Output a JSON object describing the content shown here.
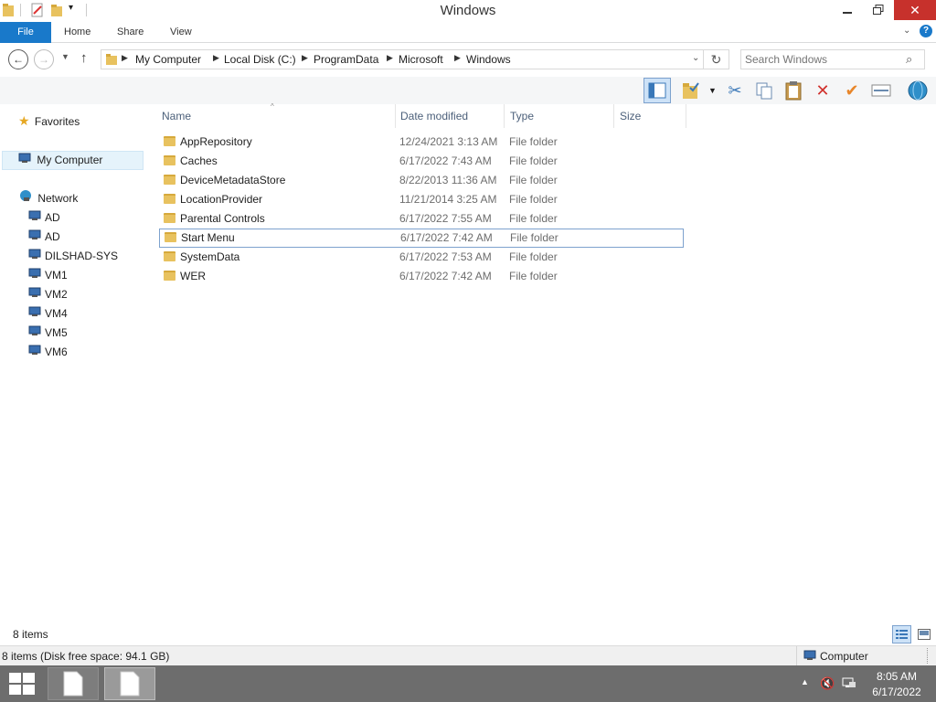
{
  "window": {
    "title": "Windows"
  },
  "ribbon": {
    "tabs": [
      "File",
      "Home",
      "Share",
      "View"
    ]
  },
  "address": {
    "crumbs": [
      "My Computer",
      "Local Disk (C:)",
      "ProgramData",
      "Microsoft",
      "Windows"
    ],
    "search_placeholder": "Search Windows"
  },
  "navpane": {
    "favorites": "Favorites",
    "my_computer": "My Computer",
    "network": "Network",
    "hosts": [
      "AD",
      "AD",
      "DILSHAD-SYS",
      "VM1",
      "VM2",
      "VM4",
      "VM5",
      "VM6"
    ]
  },
  "columns": {
    "name": "Name",
    "date": "Date modified",
    "type": "Type",
    "size": "Size"
  },
  "files": [
    {
      "name": "AppRepository",
      "date": "12/24/2021 3:13 AM",
      "type": "File folder"
    },
    {
      "name": "Caches",
      "date": "6/17/2022 7:43 AM",
      "type": "File folder"
    },
    {
      "name": "DeviceMetadataStore",
      "date": "8/22/2013 11:36 AM",
      "type": "File folder"
    },
    {
      "name": "LocationProvider",
      "date": "11/21/2014 3:25 AM",
      "type": "File folder"
    },
    {
      "name": "Parental Controls",
      "date": "6/17/2022 7:55 AM",
      "type": "File folder"
    },
    {
      "name": "Start Menu",
      "date": "6/17/2022 7:42 AM",
      "type": "File folder"
    },
    {
      "name": "SystemData",
      "date": "6/17/2022 7:53 AM",
      "type": "File folder"
    },
    {
      "name": "WER",
      "date": "6/17/2022 7:42 AM",
      "type": "File folder"
    }
  ],
  "status": {
    "items": "8 items",
    "disk": "8 items (Disk free space: 94.1 GB)",
    "computer": "Computer"
  },
  "clock": {
    "time": "8:05 AM",
    "date": "6/17/2022"
  },
  "colors": {
    "accent": "#1979ca",
    "close": "#c7312c",
    "taskbar": "#6d6d6d",
    "selection_border": "#7da2ce"
  }
}
